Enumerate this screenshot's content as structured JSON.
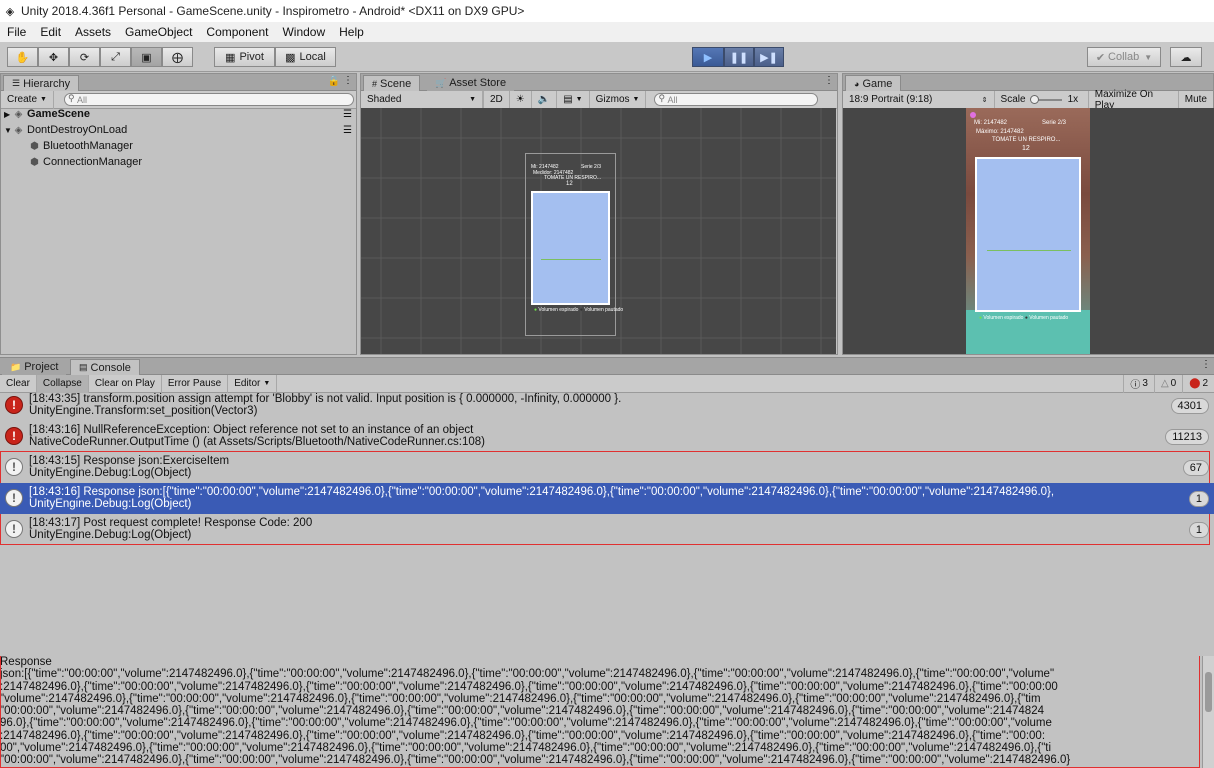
{
  "window": {
    "title": "Unity 2018.4.36f1 Personal - GameScene.unity - Inspirometro - Android* <DX11 on DX9 GPU>"
  },
  "menu": [
    "File",
    "Edit",
    "Assets",
    "GameObject",
    "Component",
    "Window",
    "Help"
  ],
  "toolbar": {
    "pivot_label": "Pivot",
    "local_label": "Local",
    "collab_label": "Collab",
    "tool_icons": [
      "hand-icon",
      "move-icon",
      "rotate-icon",
      "scale-icon",
      "rect-icon",
      "transform-icon"
    ]
  },
  "hierarchy": {
    "tab": "Hierarchy",
    "create_label": "Create",
    "search_placeholder": "All",
    "items": [
      {
        "label": "GameScene",
        "bold": true,
        "expanded": false
      },
      {
        "label": "DontDestroyOnLoad",
        "bold": false,
        "expanded": true
      },
      {
        "label": "BluetoothManager",
        "child": true
      },
      {
        "label": "ConnectionManager",
        "child": true
      }
    ]
  },
  "scene": {
    "tabs": [
      "Scene",
      "Asset Store"
    ],
    "shading": "Shaded",
    "mode_2d": "2D",
    "gizmos": "Gizmos",
    "search_placeholder": "All",
    "preview_texts": [
      "Mi: 2147482",
      "Serie 2/3",
      "Medidor: 2147482",
      "TOMATE UN RESPIRO...",
      "12",
      "Volumen espirado",
      "Volumen pautado"
    ]
  },
  "game": {
    "tab": "Game",
    "aspect": "18:9 Portrait (9:18)",
    "scale_label": "Scale",
    "scale_value": "1x",
    "maximize": "Maximize On Play",
    "mute": "Mute",
    "hud": {
      "mi": "Mi: 2147482",
      "serie": "Serie 2/3",
      "maximo": "Máximo: 2147482",
      "msg": "TOMATE UN RESPIRO...",
      "count": "12",
      "legend1": "Volumen espirado",
      "legend2": "Volumen pautado"
    },
    "colors": {
      "panel": "#a4bff0",
      "teal": "#5cc0b0",
      "bg_top": "#8a5a4a"
    }
  },
  "console": {
    "tabs": [
      "Project",
      "Console"
    ],
    "buttons": [
      "Clear",
      "Collapse",
      "Clear on Play",
      "Error Pause",
      "Editor"
    ],
    "counts": {
      "log": "3",
      "warn": "0",
      "error": "2"
    },
    "rows": [
      {
        "type": "error",
        "line1": "[18:43:35] transform.position assign attempt for 'Blobby' is not valid. Input position is { 0.000000, -Infinity, 0.000000 }.",
        "line2": "UnityEngine.Transform:set_position(Vector3)",
        "count": "4301"
      },
      {
        "type": "error",
        "line1": "[18:43:16] NullReferenceException: Object reference not set to an instance of an object",
        "line2": "NativeCodeRunner.OutputTime () (at Assets/Scripts/Bluetooth/NativeCodeRunner.cs:108)",
        "count": "11213"
      },
      {
        "type": "log",
        "line1": "[18:43:15] Response json:ExerciseItem",
        "line2": "UnityEngine.Debug:Log(Object)",
        "count": "67"
      },
      {
        "type": "log",
        "selected": true,
        "line1": "[18:43:16] Response json:[{\"time\":\"00:00:00\",\"volume\":2147482496.0},{\"time\":\"00:00:00\",\"volume\":2147482496.0},{\"time\":\"00:00:00\",\"volume\":2147482496.0},{\"time\":\"00:00:00\",\"volume\":2147482496.0},",
        "line2": "UnityEngine.Debug:Log(Object)",
        "count": "1"
      },
      {
        "type": "log",
        "line1": "[18:43:17] Post request complete! Response Code: 200",
        "line2": "UnityEngine.Debug:Log(Object)",
        "count": "1"
      }
    ],
    "detail": {
      "lines": [
        "Response",
        "json:[{\"time\":\"00:00:00\",\"volume\":2147482496.0},{\"time\":\"00:00:00\",\"volume\":2147482496.0},{\"time\":\"00:00:00\",\"volume\":2147482496.0},{\"time\":\"00:00:00\",\"volume\":2147482496.0},{\"time\":\"00:00:00\",\"volume\"",
        ":2147482496.0},{\"time\":\"00:00:00\",\"volume\":2147482496.0},{\"time\":\"00:00:00\",\"volume\":2147482496.0},{\"time\":\"00:00:00\",\"volume\":2147482496.0},{\"time\":\"00:00:00\",\"volume\":2147482496.0},{\"time\":\"00:00:00",
        "\"volume\":2147482496.0},{\"time\":\"00:00:00\",\"volume\":2147482496.0},{\"time\":\"00:00:00\",\"volume\":2147482496.0},{\"time\":\"00:00:00\",\"volume\":2147482496.0},{\"time\":\"00:00:00\",\"volume\":2147482496.0},{\"tim",
        "\"00:00:00\",\"volume\":2147482496.0},{\"time\":\"00:00:00\",\"volume\":2147482496.0},{\"time\":\"00:00:00\",\"volume\":2147482496.0},{\"time\":\"00:00:00\",\"volume\":2147482496.0},{\"time\":\"00:00:00\",\"volume\":21474824",
        "96.0},{\"time\":\"00:00:00\",\"volume\":2147482496.0},{\"time\":\"00:00:00\",\"volume\":2147482496.0},{\"time\":\"00:00:00\",\"volume\":2147482496.0},{\"time\":\"00:00:00\",\"volume\":2147482496.0},{\"time\":\"00:00:00\",\"volume",
        ":2147482496.0},{\"time\":\"00:00:00\",\"volume\":2147482496.0},{\"time\":\"00:00:00\",\"volume\":2147482496.0},{\"time\":\"00:00:00\",\"volume\":2147482496.0},{\"time\":\"00:00:00\",\"volume\":2147482496.0},{\"time\":\"00:00:",
        "00\",\"volume\":2147482496.0},{\"time\":\"00:00:00\",\"volume\":2147482496.0},{\"time\":\"00:00:00\",\"volume\":2147482496.0},{\"time\":\"00:00:00\",\"volume\":2147482496.0},{\"time\":\"00:00:00\",\"volume\":2147482496.0},{\"ti",
        "\"00:00:00\",\"volume\":2147482496.0},{\"time\":\"00:00:00\",\"volume\":2147482496.0},{\"time\":\"00:00:00\",\"volume\":2147482496.0},{\"time\":\"00:00:00\",\"volume\":2147482496.0},{\"time\":\"00:00:00\",\"volume\":2147482496.0}"
      ]
    }
  }
}
